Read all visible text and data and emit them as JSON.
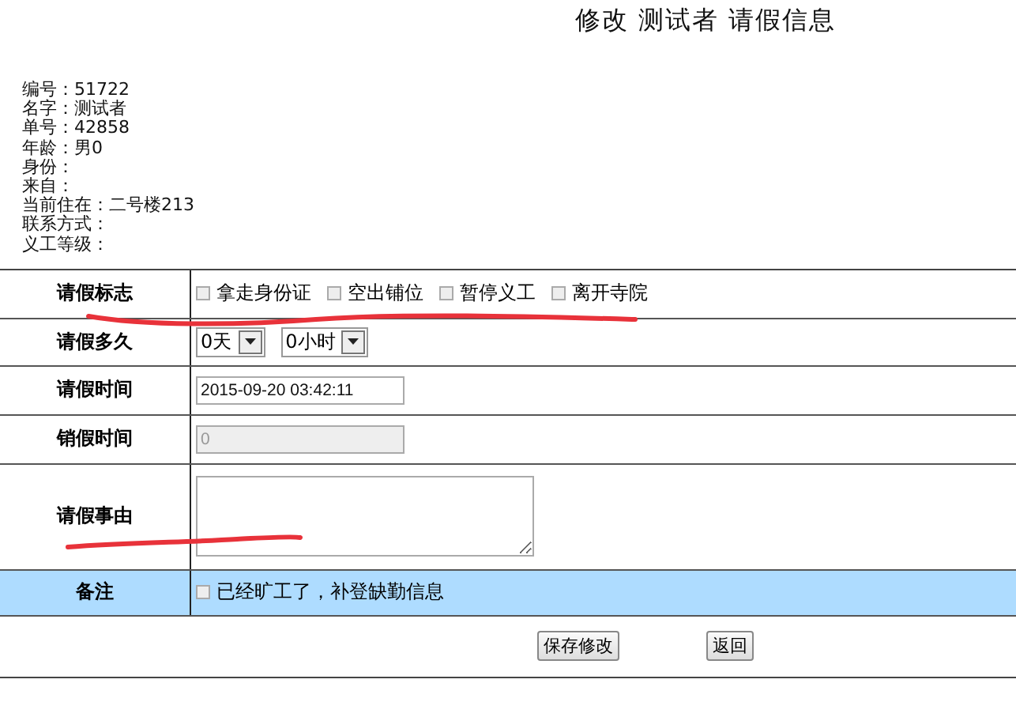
{
  "title": "修改 测试者 请假信息",
  "info": [
    "编号：51722",
    "名字：测试者",
    "单号：42858",
    "年龄：男0",
    "身份：",
    "来自：",
    "当前住在：二号楼213",
    "联系方式：",
    "义工等级："
  ],
  "form": [
    {
      "kind": "checks",
      "label": "请假标志",
      "options": [
        {
          "label": "拿走身份证",
          "checked": false
        },
        {
          "label": "空出铺位",
          "checked": false
        },
        {
          "label": "暂停义工",
          "checked": false
        },
        {
          "label": "离开寺院",
          "checked": false
        }
      ]
    },
    {
      "kind": "selects",
      "label": "请假多久",
      "selects": [
        "0天",
        "0小时"
      ]
    },
    {
      "kind": "input",
      "label": "请假时间",
      "value": "2015-09-20 03:42:11",
      "disabled": false
    },
    {
      "kind": "input",
      "label": "销假时间",
      "value": "0",
      "disabled": true
    },
    {
      "kind": "textarea",
      "label": "请假事由"
    },
    {
      "kind": "note",
      "label": "备注",
      "options": [
        {
          "label": "已经旷工了，补登缺勤信息",
          "checked": false
        }
      ]
    }
  ],
  "buttons": [
    "保存修改",
    "返回"
  ]
}
